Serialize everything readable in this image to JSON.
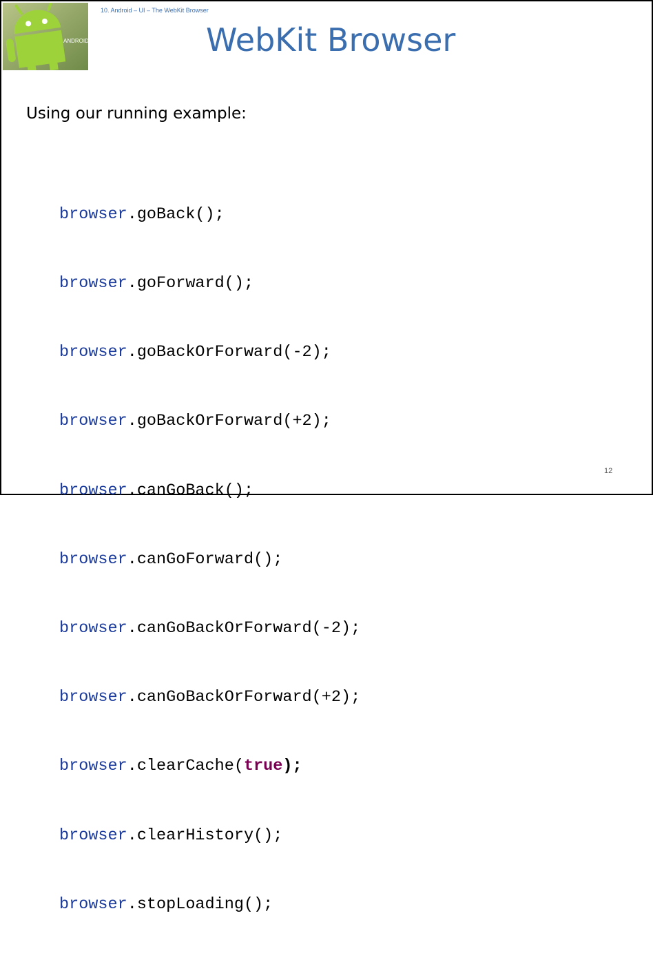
{
  "slide": {
    "breadcrumb": "10. Android – UI – The WebKit Browser",
    "title": "WebKit Browser",
    "intro": "Using our running example:",
    "page_number": "12",
    "colors": {
      "title": "#3b6eaf",
      "code_object": "#1a3a9c",
      "keyword": "#7a0052"
    }
  },
  "code_lines": [
    {
      "object": "browser",
      "rest": ".goBack();"
    },
    {
      "object": "browser",
      "rest": ".goForward();"
    },
    {
      "object": "browser",
      "rest": ".goBackOrForward(-2);"
    },
    {
      "object": "browser",
      "rest": ".goBackOrForward(+2);"
    },
    {
      "object": "browser",
      "rest": ".canGoBack();"
    },
    {
      "object": "browser",
      "rest": ".canGoForward();"
    },
    {
      "object": "browser",
      "rest": ".canGoBackOrForward(-2);"
    },
    {
      "object": "browser",
      "rest": ".canGoBackOrForward(+2);"
    },
    {
      "object": "browser",
      "rest": ".clearCache(",
      "keyword": "true",
      "tail": ");"
    },
    {
      "object": "browser",
      "rest": ".clearHistory();"
    },
    {
      "object": "browser",
      "rest": ".stopLoading();"
    }
  ],
  "logo": {
    "icon": "android-robot-icon",
    "text": "ANDROID"
  }
}
